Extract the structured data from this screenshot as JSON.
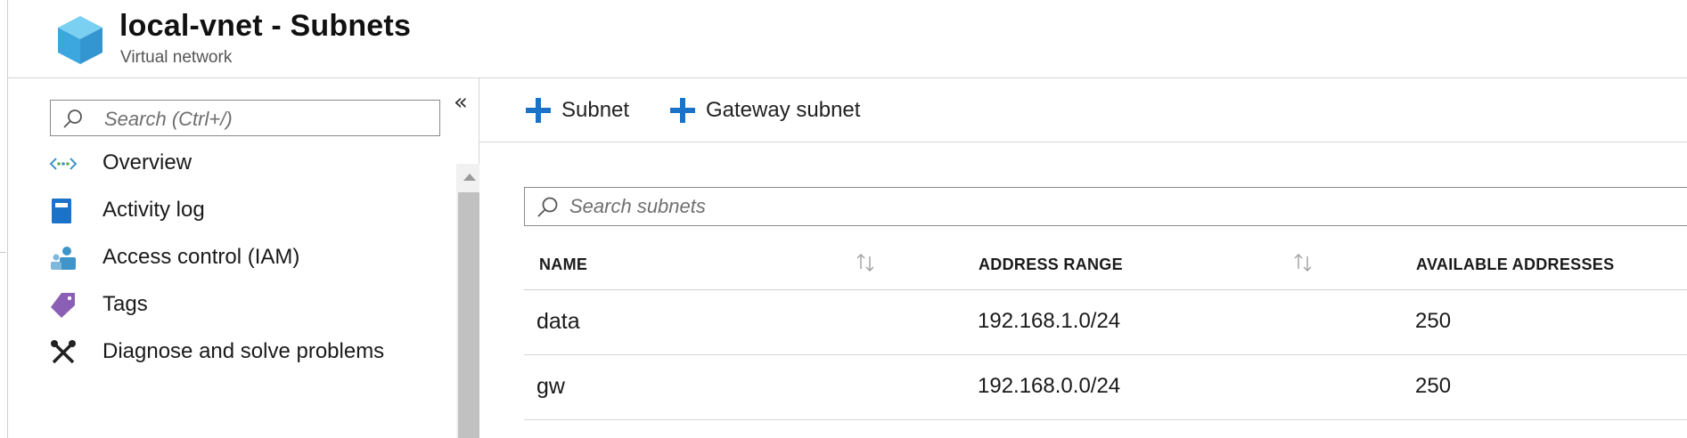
{
  "header": {
    "title": "local-vnet - Subnets",
    "subtitle": "Virtual network",
    "icon": "virtual-network-cube-icon"
  },
  "menu": {
    "search_placeholder": "Search (Ctrl+/)",
    "collapse_glyph": "«",
    "items": [
      {
        "label": "Overview",
        "icon": "overview-icon"
      },
      {
        "label": "Activity log",
        "icon": "activity-log-icon"
      },
      {
        "label": "Access control (IAM)",
        "icon": "iam-icon"
      },
      {
        "label": "Tags",
        "icon": "tag-icon"
      },
      {
        "label": "Diagnose and solve problems",
        "icon": "wrench-icon"
      }
    ]
  },
  "toolbar": {
    "add_subnet_label": "Subnet",
    "add_gateway_subnet_label": "Gateway subnet"
  },
  "subnets": {
    "search_placeholder": "Search subnets",
    "columns": [
      "NAME",
      "ADDRESS RANGE",
      "AVAILABLE ADDRESSES"
    ],
    "rows": [
      {
        "name": "data",
        "address_range": "192.168.1.0/24",
        "available": "250"
      },
      {
        "name": "gw",
        "address_range": "192.168.0.0/24",
        "available": "250"
      }
    ]
  },
  "colors": {
    "accent_blue": "#1a73c8",
    "border": "#d6d6d6",
    "tag_purple": "#8a5fb5",
    "iam_teal": "#3f95c9"
  }
}
